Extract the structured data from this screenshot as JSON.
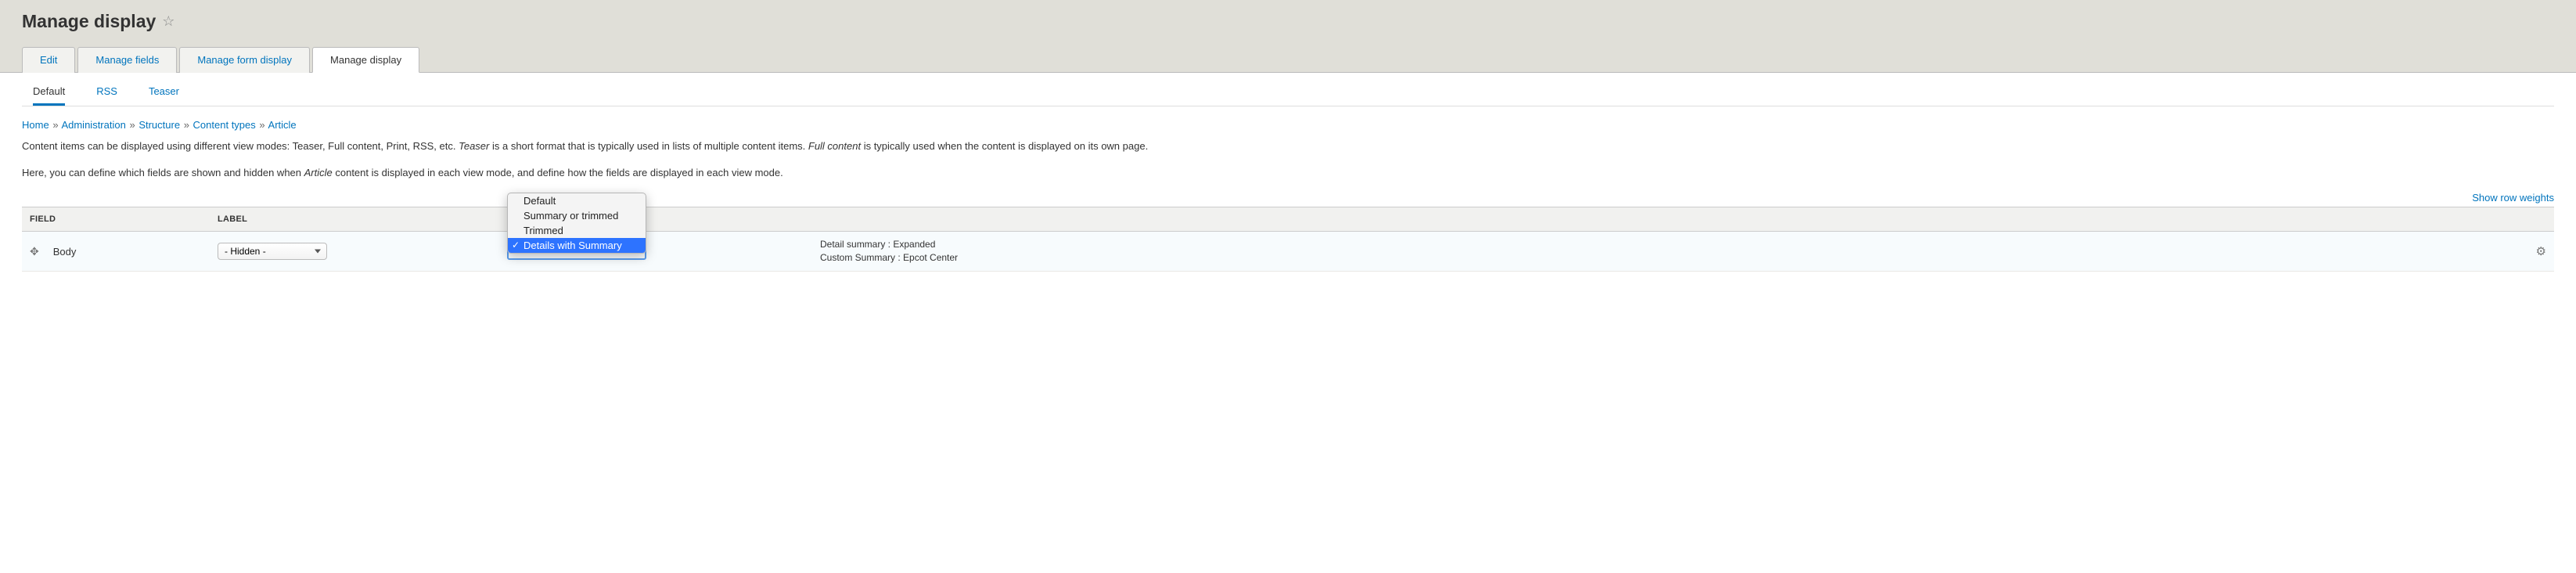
{
  "page": {
    "title": "Manage display"
  },
  "primary_tabs": [
    {
      "label": "Edit",
      "active": false
    },
    {
      "label": "Manage fields",
      "active": false
    },
    {
      "label": "Manage form display",
      "active": false
    },
    {
      "label": "Manage display",
      "active": true
    }
  ],
  "secondary_tabs": [
    {
      "label": "Default",
      "active": true
    },
    {
      "label": "RSS",
      "active": false
    },
    {
      "label": "Teaser",
      "active": false
    }
  ],
  "breadcrumb": {
    "items": [
      "Home",
      "Administration",
      "Structure",
      "Content types",
      "Article"
    ],
    "sep": "»"
  },
  "intro": {
    "p1_a": "Content items can be displayed using different view modes: Teaser, Full content, Print, RSS, etc. ",
    "p1_em1": "Teaser",
    "p1_b": " is a short format that is typically used in lists of multiple content items. ",
    "p1_em2": "Full content",
    "p1_c": " is typically used when the content is displayed on its own page.",
    "p2_a": "Here, you can define which fields are shown and hidden when ",
    "p2_em": "Article",
    "p2_b": " content is displayed in each view mode, and define how the fields are displayed in each view mode."
  },
  "row_weights_link": "Show row weights",
  "table": {
    "headers": {
      "field": "Field",
      "label": "Label",
      "format": "",
      "summary": "",
      "ops": ""
    },
    "row": {
      "field_name": "Body",
      "label_select": "- Hidden -",
      "format_options": [
        {
          "text": "Default",
          "selected": false
        },
        {
          "text": "Summary or trimmed",
          "selected": false
        },
        {
          "text": "Trimmed",
          "selected": false
        },
        {
          "text": "Details with Summary",
          "selected": true
        }
      ],
      "summary_line1": "Detail summary : Expanded",
      "summary_line2": "Custom Summary : Epcot Center"
    }
  }
}
